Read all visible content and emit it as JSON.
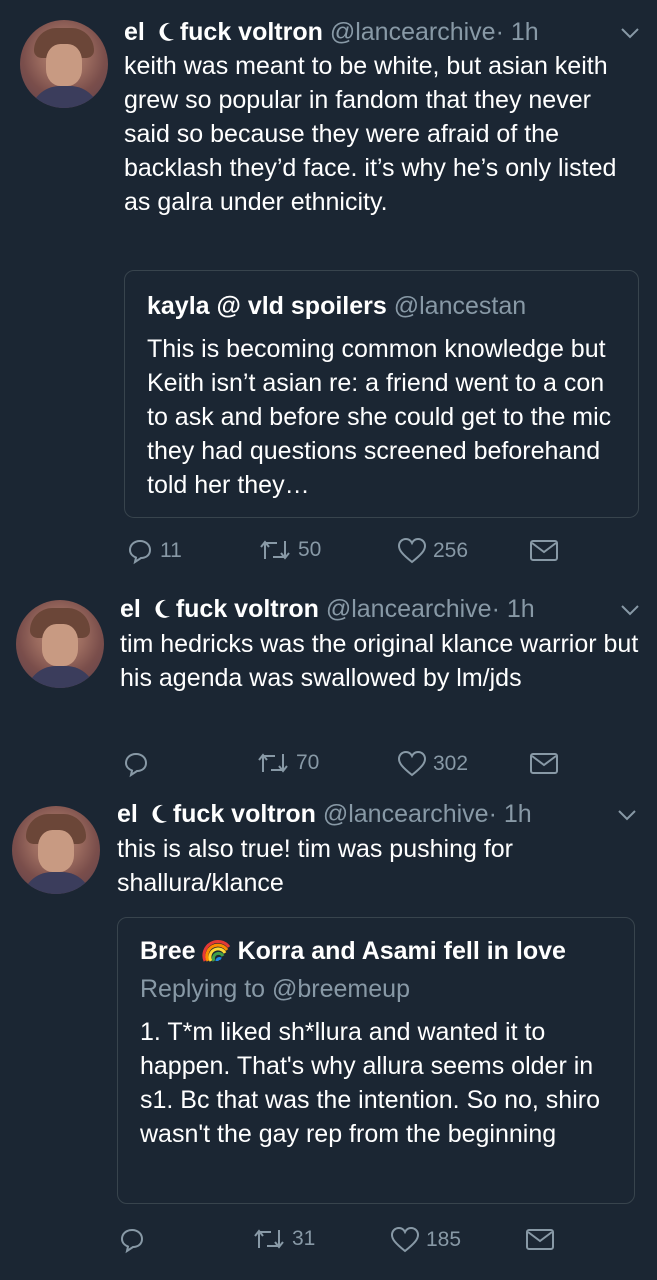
{
  "tweets": [
    {
      "name": "el",
      "name2": "fuck voltron",
      "handle": "@lancearchive",
      "time": "· 1h",
      "text": "keith was meant to be white, but asian keith grew so popular in fandom that they never said so because they were afraid of the backlash they’d face. it’s why he’s only listed as galra under ethnicity.",
      "quote": {
        "name": "kayla @ vld spoilers",
        "handle": "@lancestan",
        "text": "This is becoming common knowledge but Keith isn’t asian re: a friend went to a con to ask and before she could get to the mic they had questions screened beforehand told her they…"
      },
      "replies": "11",
      "retweets": "50",
      "likes": "256"
    },
    {
      "name": "el",
      "name2": "fuck voltron",
      "handle": "@lancearchive",
      "time": "· 1h",
      "text": "tim hedricks was the original klance warrior but his agenda was swallowed by lm/jds",
      "replies": "",
      "retweets": "70",
      "likes": "302"
    },
    {
      "name": "el",
      "name2": "fuck voltron",
      "handle": "@lancearchive",
      "time": "· 1h",
      "text": "this is also true! tim was pushing for shallura/klance",
      "quote": {
        "name": "Bree",
        "name2": "Korra and Asami fell in love",
        "reply": "Replying to @breemeup",
        "text": "1. T*m liked sh*llura and wanted it to happen. That's why allura seems older in s1. Bc that was the intention. So no, shiro wasn't the gay rep from the beginning"
      },
      "replies": "",
      "retweets": "31",
      "likes": "185"
    }
  ],
  "colors": {
    "background": "#1b2633",
    "secondary": "#8899a6",
    "border": "#38444d"
  }
}
